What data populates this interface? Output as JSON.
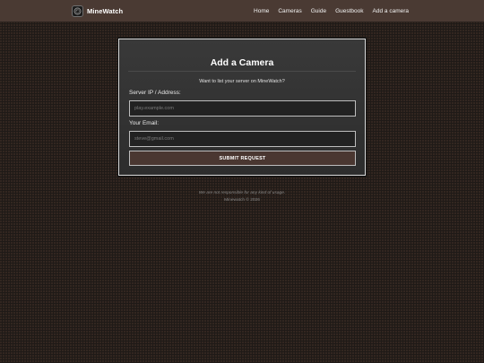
{
  "nav": {
    "brand": "MineWatch",
    "links": [
      "Home",
      "Cameras",
      "Guide",
      "Guestbook",
      "Add a camera"
    ]
  },
  "form": {
    "title": "Add a Camera",
    "subtitle": "Want to list your server on MineWatch?",
    "server_label": "Server IP / Address:",
    "server_placeholder": "play.example.com",
    "server_value": "",
    "email_label": "Your Email:",
    "email_placeholder": "steve@gmail.com",
    "email_value": "",
    "submit_label": "SUBMIT REQUEST"
  },
  "footer": {
    "disclaimer": "We are not responsible for any kind of usage.",
    "copyright": "Minewatch © 2026"
  },
  "colors": {
    "navbar": "#4a3a33",
    "background": "#1f1a17",
    "card": "#333333",
    "button": "#4a3731"
  },
  "icons": {
    "logo": "camera-lens-icon"
  }
}
